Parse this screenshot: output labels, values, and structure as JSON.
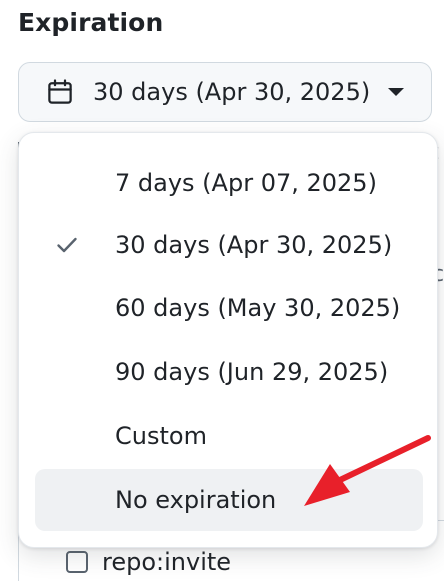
{
  "field": {
    "label": "Expiration",
    "selected_text": "30 days (Apr 30, 2025)",
    "icon": "calendar-icon"
  },
  "dropdown": {
    "options": [
      {
        "label": "7 days (Apr 07, 2025)",
        "selected": false
      },
      {
        "label": "30 days (Apr 30, 2025)",
        "selected": true
      },
      {
        "label": "60 days (May 30, 2025)",
        "selected": false
      },
      {
        "label": "90 days (Jun 29, 2025)",
        "selected": false
      },
      {
        "label": "Custom",
        "selected": false
      },
      {
        "label": "No expiration",
        "selected": false,
        "highlighted": true
      }
    ]
  },
  "background": {
    "checkbox_label": "repo:invite"
  },
  "annotation": {
    "arrow_color": "#e8202a"
  },
  "colors": {
    "text": "#1f2328",
    "muted": "#59636e",
    "border": "#d1d9e0",
    "button_bg": "#f6f8fa",
    "hover_bg": "#eff1f3"
  }
}
